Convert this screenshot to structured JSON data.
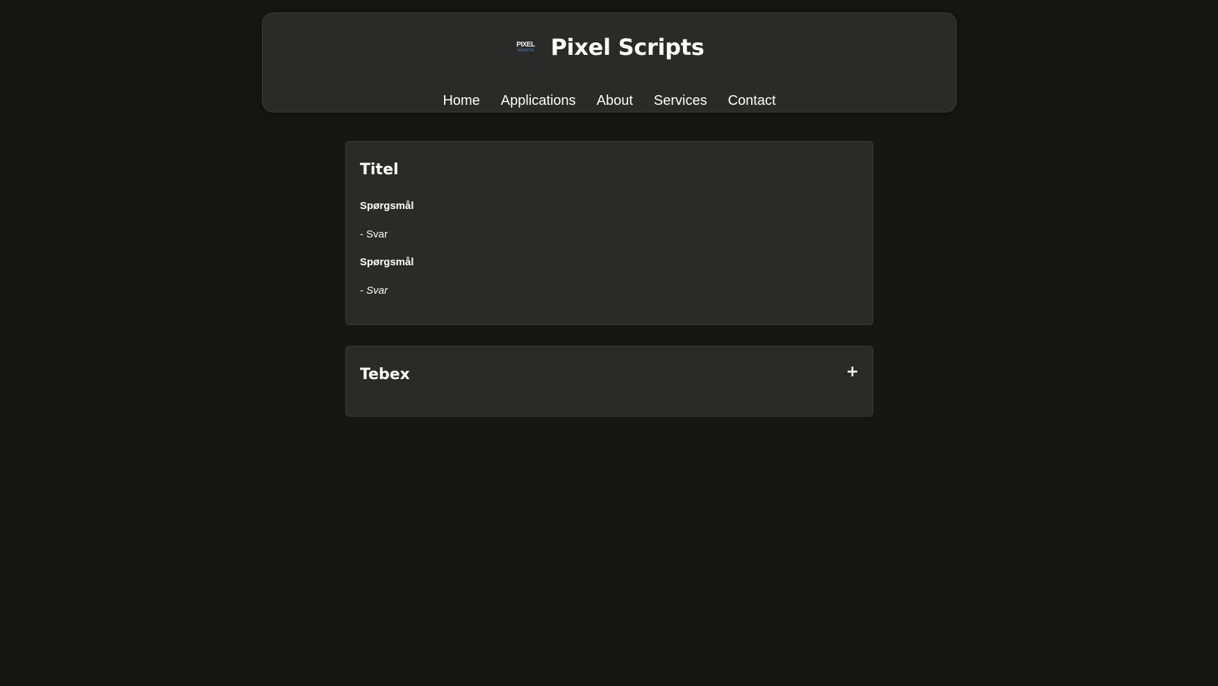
{
  "header": {
    "logo": {
      "icon": "pixel-scripts-logo",
      "line1": "PIXEL",
      "line2": "SCRIPTS"
    },
    "title": "Pixel Scripts",
    "nav": [
      {
        "label": "Home"
      },
      {
        "label": "Applications"
      },
      {
        "label": "About"
      },
      {
        "label": "Services"
      },
      {
        "label": "Contact"
      }
    ]
  },
  "faq_card": {
    "title": "Titel",
    "items": [
      {
        "question": "Spørgsmål",
        "answer": "- Svar"
      },
      {
        "question": "Spørgsmål",
        "answer": "- Svar"
      }
    ]
  },
  "tebex_card": {
    "title": "Tebex",
    "toggle_symbol": "+",
    "toggle_icon": "plus-icon"
  },
  "colors": {
    "page_background": "#161615",
    "card_background": "#2a2a29",
    "text": "#ffffff",
    "logo_accent": "#4a9fe0"
  }
}
